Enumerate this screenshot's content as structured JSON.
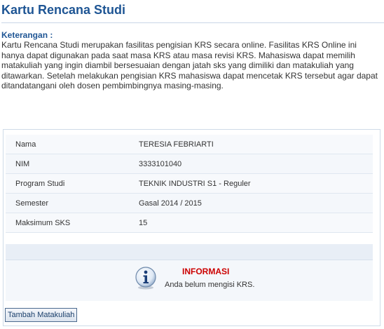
{
  "page": {
    "title": "Kartu Rencana Studi"
  },
  "keterangan": {
    "heading": "Keterangan :",
    "body": "Kartu Rencana Studi merupakan fasilitas pengisian KRS secara online. Fasilitas KRS Online ini hanya dapat digunakan pada saat masa KRS atau masa revisi KRS. Mahasiswa dapat memilih matakuliah yang ingin diambil bersesuaian dengan jatah sks yang dimiliki dan matakuliah yang ditawarkan. Setelah melakukan pengisian KRS mahasiswa dapat mencetak KRS tersebut agar dapat ditandatangani oleh dosen pembimbingnya masing-masing."
  },
  "student": {
    "rows": [
      {
        "label": "Nama",
        "value": "TERESIA FEBRIARTI"
      },
      {
        "label": "NIM",
        "value": "3333101040"
      },
      {
        "label": "Program Studi",
        "value": "TEKNIK INDUSTRI S1 - Reguler"
      },
      {
        "label": "Semester",
        "value": "Gasal 2014 / 2015"
      },
      {
        "label": "Maksimum SKS",
        "value": "15"
      }
    ]
  },
  "info": {
    "icon": "info-icon",
    "title": "INFORMASI",
    "message": "Anda belum mengisi KRS."
  },
  "actions": {
    "add_course_label": "Tambah Matakuliah"
  },
  "colors": {
    "title": "#1e5594",
    "info_title": "#cc0000"
  }
}
